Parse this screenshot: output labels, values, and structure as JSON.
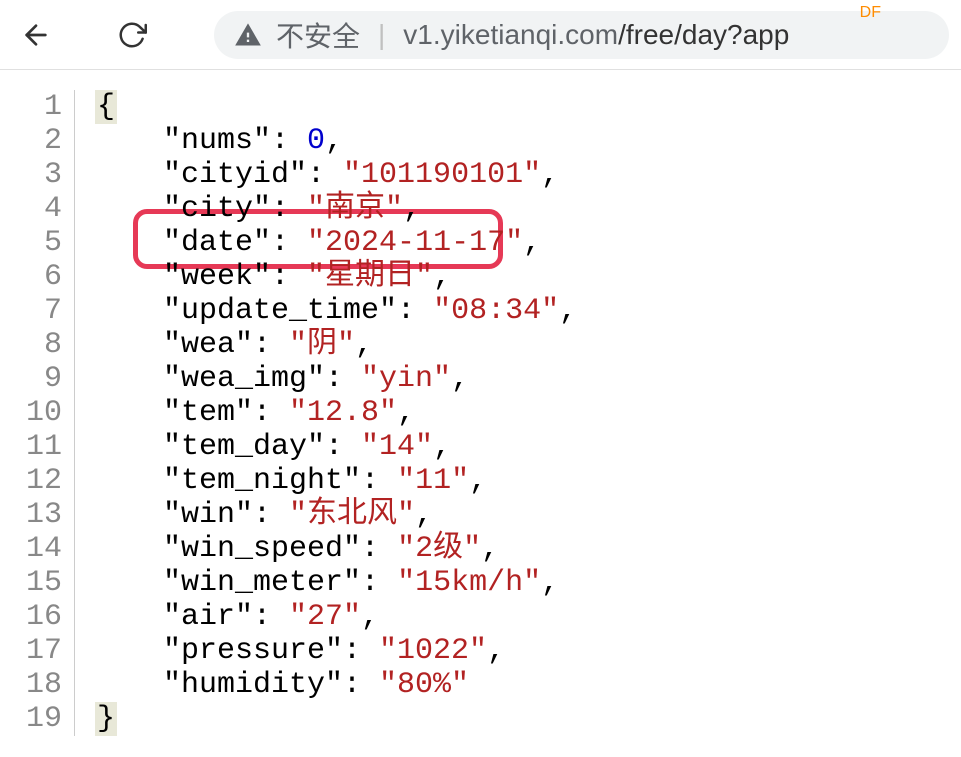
{
  "browser": {
    "security_label": "不安全",
    "url_host": "v1.yiketianqi.com",
    "url_path": "/free/day?app",
    "df_badge": "DF"
  },
  "gutter": [
    "1",
    "2",
    "3",
    "4",
    "5",
    "6",
    "7",
    "8",
    "9",
    "10",
    "11",
    "12",
    "13",
    "14",
    "15",
    "16",
    "17",
    "18",
    "19"
  ],
  "json": {
    "nums_key": "\"nums\"",
    "nums_val": "0",
    "cityid_key": "\"cityid\"",
    "cityid_val": "\"101190101\"",
    "city_key": "\"city\"",
    "city_val": "\"南京\"",
    "date_key": "\"date\"",
    "date_val": "\"2024-11-17\"",
    "week_key": "\"week\"",
    "week_val": "\"星期日\"",
    "update_time_key": "\"update_time\"",
    "update_time_val": "\"08:34\"",
    "wea_key": "\"wea\"",
    "wea_val": "\"阴\"",
    "wea_img_key": "\"wea_img\"",
    "wea_img_val": "\"yin\"",
    "tem_key": "\"tem\"",
    "tem_val": "\"12.8\"",
    "tem_day_key": "\"tem_day\"",
    "tem_day_val": "\"14\"",
    "tem_night_key": "\"tem_night\"",
    "tem_night_val": "\"11\"",
    "win_key": "\"win\"",
    "win_val": "\"东北风\"",
    "win_speed_key": "\"win_speed\"",
    "win_speed_val": "\"2级\"",
    "win_meter_key": "\"win_meter\"",
    "win_meter_val": "\"15km/h\"",
    "air_key": "\"air\"",
    "air_val": "\"27\"",
    "pressure_key": "\"pressure\"",
    "pressure_val": "\"1022\"",
    "humidity_key": "\"humidity\"",
    "humidity_val": "\"80%\""
  }
}
